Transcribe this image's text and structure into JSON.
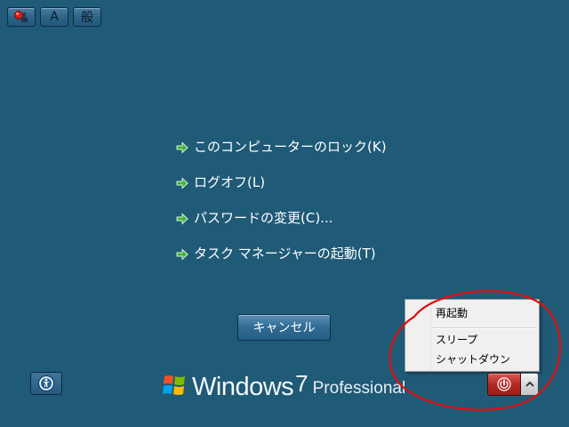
{
  "ime": {
    "mode_label": "A",
    "input_label": "般",
    "lang_icon": "ime-language-icon"
  },
  "options": [
    {
      "label": "このコンピューターのロック(K)",
      "icon": "green-arrow-icon"
    },
    {
      "label": "ログオフ(L)",
      "icon": "green-arrow-icon"
    },
    {
      "label": "パスワードの変更(C)...",
      "icon": "green-arrow-icon"
    },
    {
      "label": "タスク マネージャーの起動(T)",
      "icon": "green-arrow-icon"
    }
  ],
  "cancel_label": "キャンセル",
  "ease_of_access_icon": "ease-of-access-icon",
  "branding": {
    "windows": "Windows",
    "version": "7",
    "edition": "Professional"
  },
  "power_menu": {
    "items": [
      "再起動",
      "スリープ",
      "シャットダウン"
    ]
  },
  "power_button_icon": "power-icon",
  "power_options_icon": "chevron-up-icon",
  "colors": {
    "background": "#1f5a77",
    "power_button": "#b22a22",
    "annotation": "#e01010",
    "arrow": "#3fb53a"
  }
}
